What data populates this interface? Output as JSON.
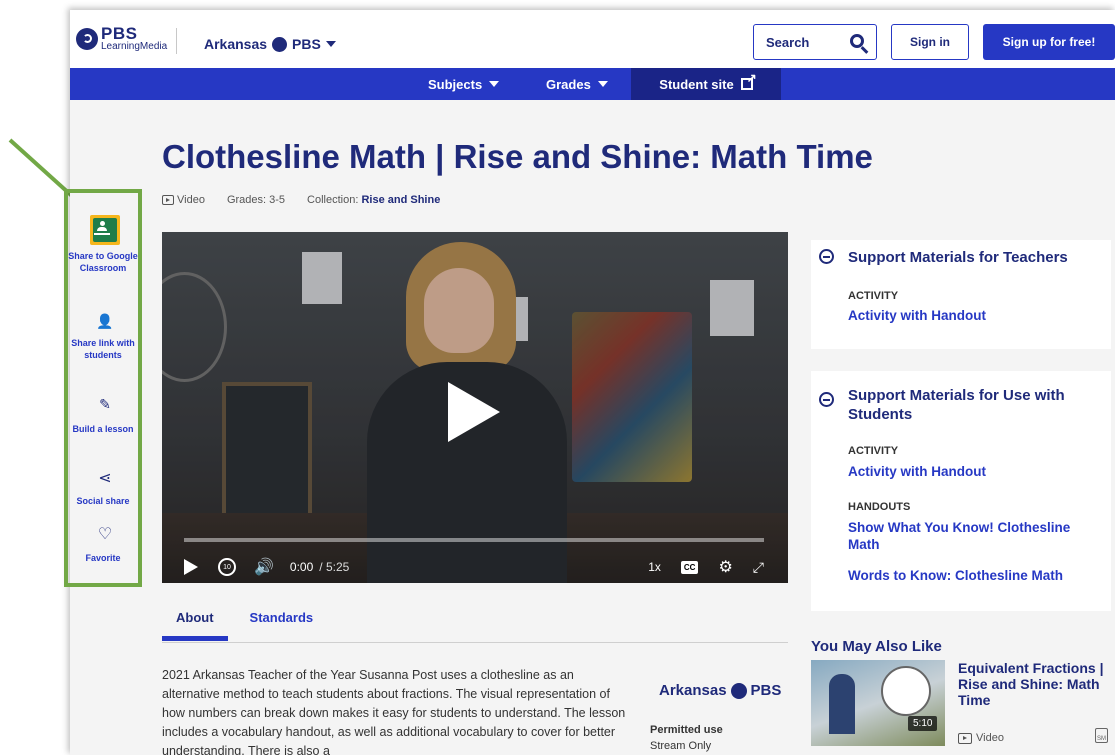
{
  "header": {
    "logo_line1": "PBS",
    "logo_line2": "LearningMedia",
    "station": "Arkansas",
    "station_suffix": "PBS",
    "search_label": "Search",
    "signin_label": "Sign in",
    "signup_label": "Sign up for free!"
  },
  "nav": {
    "subjects": "Subjects",
    "grades": "Grades",
    "student_site": "Student site"
  },
  "page": {
    "title": "Clothesline Math | Rise and Shine: Math Time",
    "meta_type": "Video",
    "meta_grades": "Grades: 3-5",
    "meta_collection_label": "Collection:",
    "meta_collection": "Rise and Shine"
  },
  "player": {
    "current_time": "0:00",
    "duration": "/ 5:25",
    "speed": "1x",
    "cc": "CC",
    "rewind": "10",
    "progress": 0
  },
  "share": {
    "classroom": "Share to Google Classroom",
    "link": "Share link with students",
    "lesson": "Build a lesson",
    "social": "Social share",
    "favorite": "Favorite"
  },
  "tabs": {
    "about": "About",
    "standards": "Standards"
  },
  "about": {
    "text": "2021 Arkansas Teacher of the Year Susanna Post uses a clothesline as an alternative method to teach students about fractions. The visual representation of how numbers can break down makes it easy for students to understand. The lesson includes a vocabulary handout, as well as additional vocabulary to cover for better understanding. There is also a",
    "brand": "Arkansas",
    "brand_suffix": "PBS",
    "permitted_label": "Permitted use",
    "permitted_value": "Stream Only"
  },
  "support_teachers": {
    "title": "Support Materials for Teachers",
    "cat": "ACTIVITY",
    "link": "Activity with Handout"
  },
  "support_students": {
    "title": "Support Materials for Use with Students",
    "cat1": "ACTIVITY",
    "link1": "Activity with Handout",
    "cat2": "HANDOUTS",
    "link2": "Show What You Know! Clothesline Math",
    "link3": "Words to Know: Clothesline Math"
  },
  "related": {
    "heading": "You May Also Like",
    "title": "Equivalent Fractions | Rise and Shine: Math Time",
    "duration": "5:10",
    "type": "Video",
    "badge": "SM"
  },
  "colors": {
    "brand_blue": "#2638c4",
    "dark_navy": "#1f2a7a",
    "highlight_green": "#72a846"
  },
  "icons": [
    "play-icon",
    "rewind-10-icon",
    "volume-icon",
    "cc-icon",
    "gear-icon",
    "fullscreen-icon",
    "search-icon",
    "external-link-icon",
    "google-classroom-icon",
    "share-link-icon",
    "build-lesson-icon",
    "share-icon",
    "heart-icon",
    "collapse-icon"
  ]
}
